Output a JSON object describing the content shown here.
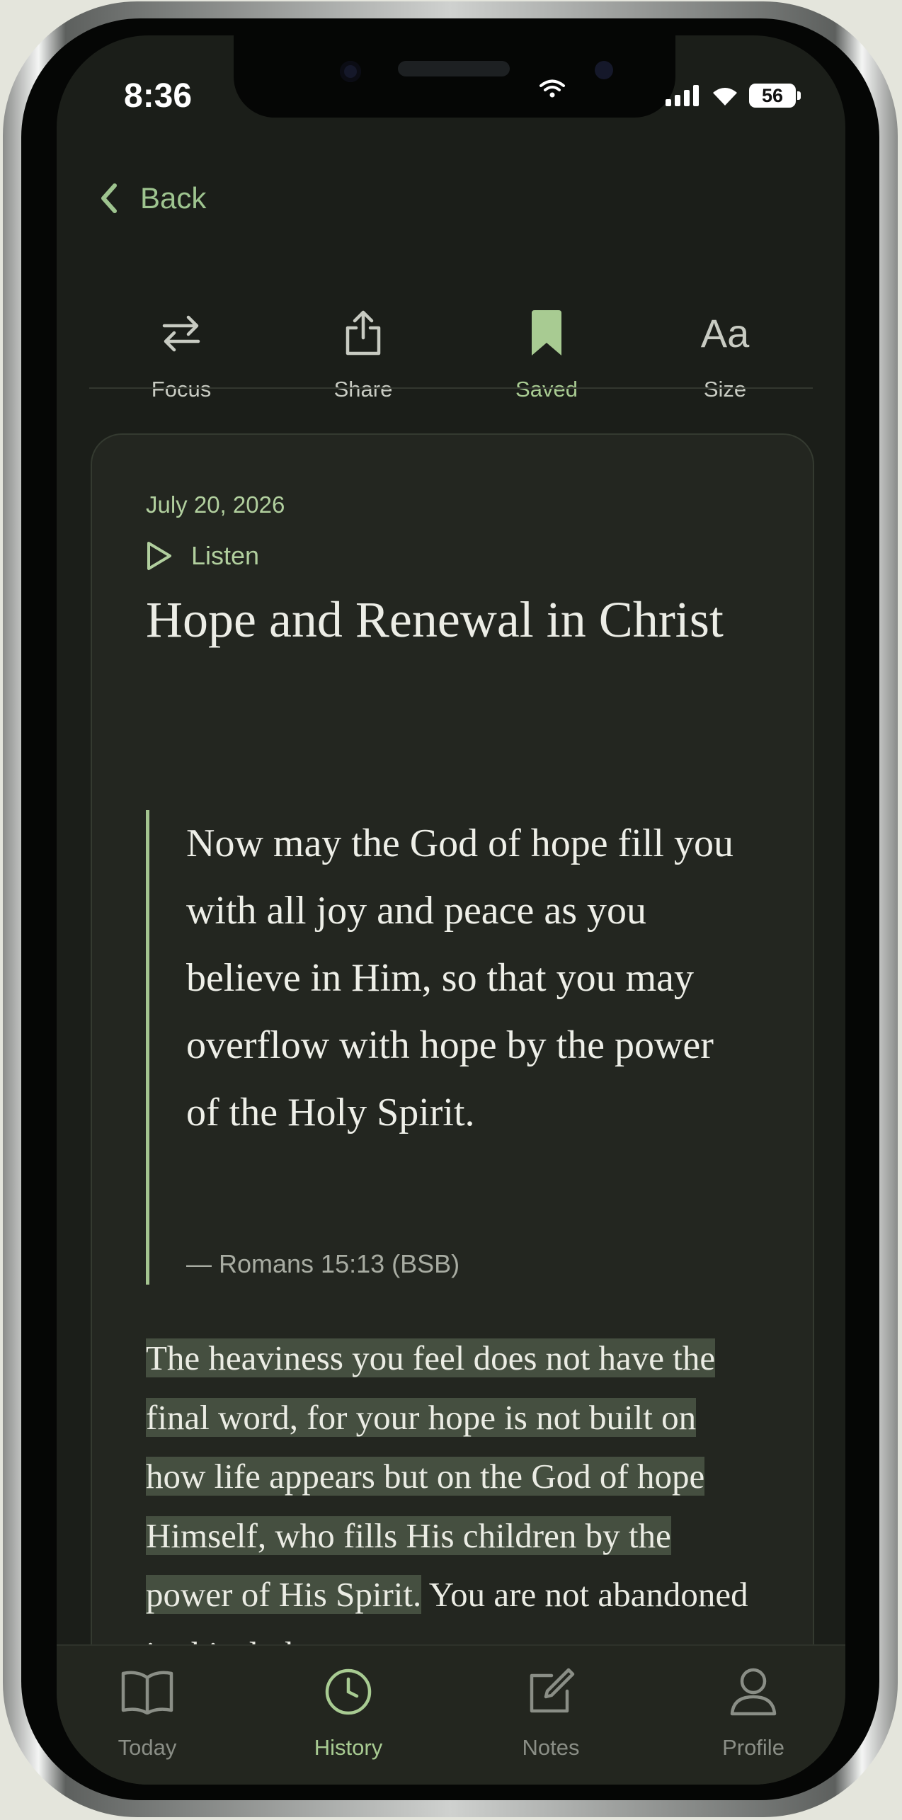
{
  "status_bar": {
    "time": "8:36",
    "battery": "56"
  },
  "nav": {
    "back_label": "Back"
  },
  "toolbar": {
    "focus_label": "Focus",
    "share_label": "Share",
    "saved_label": "Saved",
    "size_label": "Size",
    "size_icon_text": "Aa"
  },
  "devotional": {
    "date": "July 20, 2026",
    "listen_label": "Listen",
    "title": "Hope and Renewal in Christ",
    "verse": "Now may the God of hope fill you with all joy and peace as you believe in Him, so that you may overflow with hope by the power of the Holy Spirit.",
    "reference": "— Romans 15:13 (BSB)",
    "highlighted_text": "The heaviness you feel does not have the final word, for your hope is not built on how life appears but on the God of hope Himself, who fills His children by the power of His Spirit.",
    "body_text": "You are not abandoned in this dark"
  },
  "tabbar": {
    "today_label": "Today",
    "history_label": "History",
    "notes_label": "Notes",
    "profile_label": "Profile"
  },
  "colors": {
    "accent": "#a8cb92",
    "background": "#1b1e19",
    "card": "#232620",
    "highlight": "#454f40"
  }
}
